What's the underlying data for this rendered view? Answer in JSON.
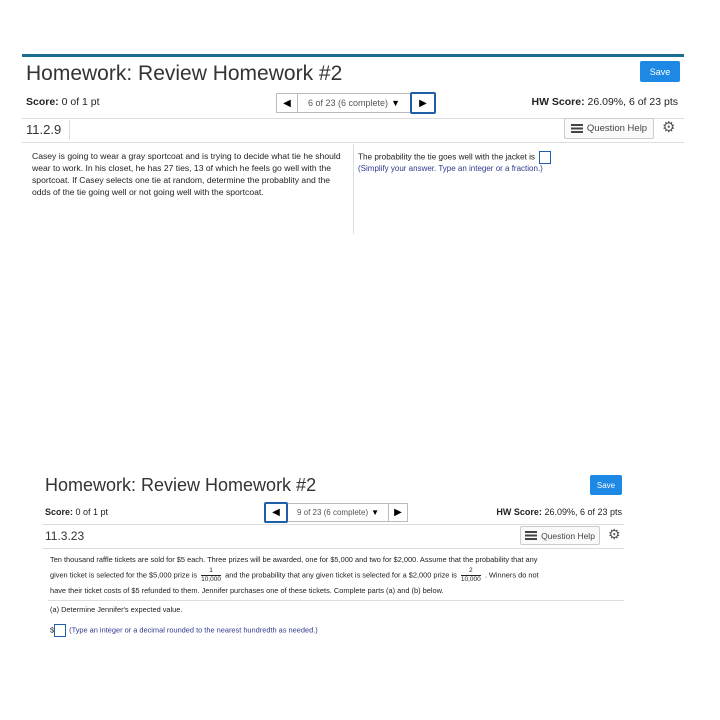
{
  "panel1": {
    "title": "Homework: Review Homework #2",
    "save_label": "Save",
    "score_label": "Score:",
    "score_value": "0 of 1 pt",
    "nav_progress": "6 of 23 (6 complete)",
    "hw_score_label": "HW Score:",
    "hw_score_value": "26.09%, 6 of 23 pts",
    "question_number": "11.2.9",
    "question_help_label": "Question Help",
    "question_text": "Casey is going to wear a gray sportcoat and is trying to decide what tie he should wear to work. In his closet, he has 27 ties, 13 of which he feels go well with the sportcoat. If Casey selects one tie at random, determine the probablity and the odds of the tie going well or not going well with the sportcoat.",
    "answer_prompt": "The probability the tie goes well with the jacket is",
    "answer_hint": "(Simplify your answer. Type an integer or a fraction.)"
  },
  "panel2": {
    "title": "Homework: Review Homework #2",
    "save_label": "Save",
    "score_label": "Score:",
    "score_value": "0 of 1 pt",
    "nav_progress": "9 of 23 (6 complete)",
    "hw_score_label": "HW Score:",
    "hw_score_value": "26.09%, 6 of 23 pts",
    "question_number": "11.3.23",
    "question_help_label": "Question Help",
    "text_line1": "Ten thousand raffle tickets are sold for $5 each. Three prizes will be awarded, one for $5,000 and two for $2,000. Assume that the probability that any",
    "text_line2a": "given ticket is selected for the $5,000 prize is",
    "frac1_num": "1",
    "frac1_den": "10,000",
    "text_line2b": "and the probability that any given ticket is selected for a $2,000 prize is",
    "frac2_num": "2",
    "frac2_den": "10,000",
    "text_line2c": ". Winners do not",
    "text_line3": "have their ticket costs of $5 refunded to them. Jennifer purchases one of these tickets. Complete parts (a) and (b) below.",
    "part_a": "(a) Determine Jennifer's expected value.",
    "dollar": "$",
    "answer_hint": "(Type an integer or a decimal rounded to the nearest hundredth as needed.)"
  },
  "icons": {
    "prev": "◀",
    "next": "▶",
    "dropdown": "▼",
    "gear": "⚙"
  }
}
